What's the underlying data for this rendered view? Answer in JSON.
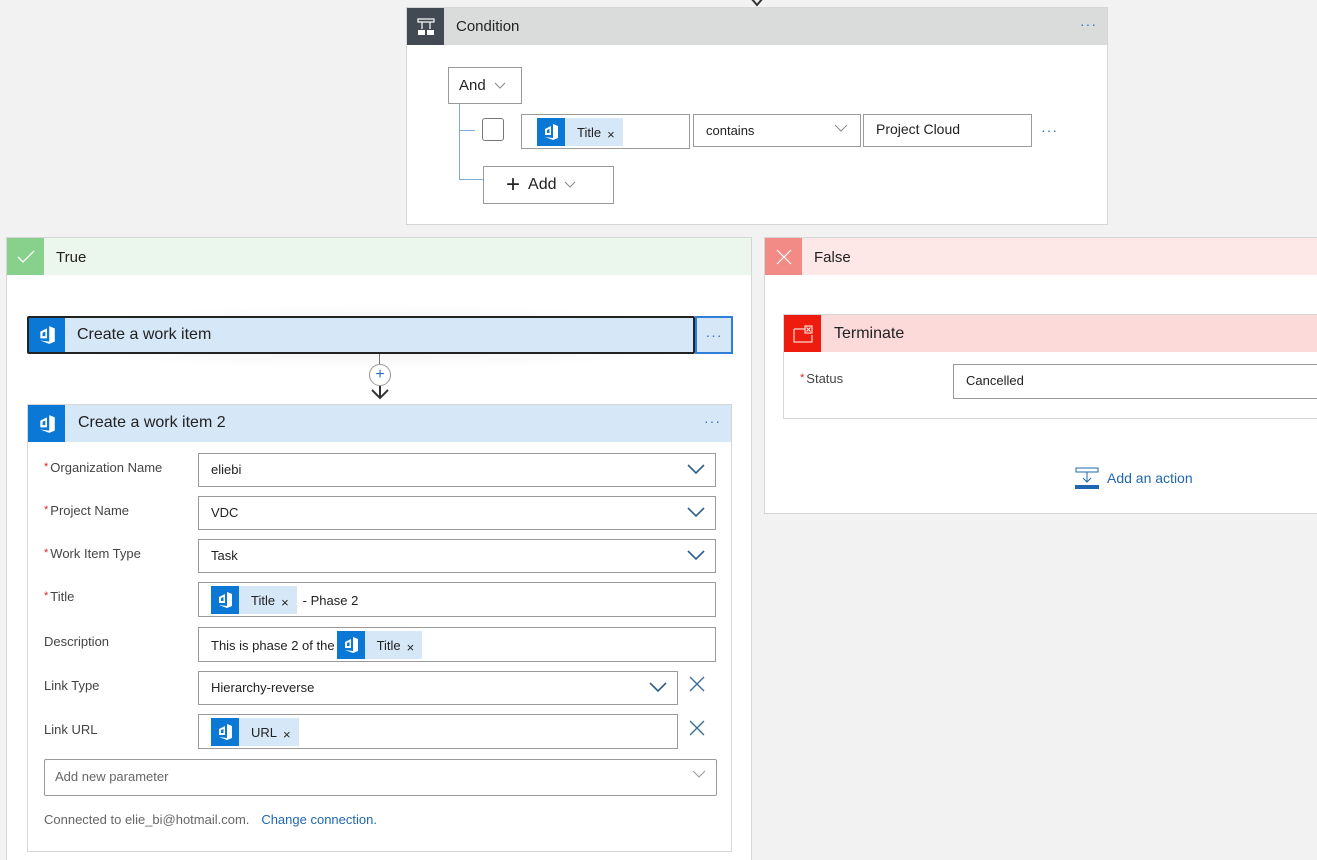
{
  "condition": {
    "title": "Condition",
    "icon": "condition-icon",
    "more_label": "···",
    "operator_group": "And",
    "rows": [
      {
        "left_token": {
          "label": "Title",
          "remove": "×",
          "icon": "azure-devops-icon"
        },
        "operator": "contains",
        "right_value": "Project Cloud",
        "more_label": "···"
      }
    ],
    "add_label": "Add"
  },
  "true_branch": {
    "title": "True",
    "icon": "check-icon",
    "actions": [
      {
        "title": "Create a work item",
        "more_label": "···"
      },
      {
        "title": "Create a work item 2",
        "more_label": "···",
        "params": {
          "org": {
            "label": "Organization Name",
            "required": true,
            "value": "eliebi"
          },
          "project": {
            "label": "Project Name",
            "required": true,
            "value": "VDC"
          },
          "type": {
            "label": "Work Item Type",
            "required": true,
            "value": "Task"
          },
          "title": {
            "label": "Title",
            "required": true,
            "token": "Title",
            "token_remove": "×",
            "suffix": "- Phase 2"
          },
          "description": {
            "label": "Description",
            "required": false,
            "prefix": "This is phase 2 of the",
            "token": "Title",
            "token_remove": "×"
          },
          "link_type": {
            "label": "Link Type",
            "required": false,
            "value": "Hierarchy-reverse"
          },
          "link_url": {
            "label": "Link URL",
            "required": false,
            "token": "URL",
            "token_remove": "×"
          }
        },
        "add_param_placeholder": "Add new parameter",
        "connection_text": "Connected to elie_bi@hotmail.com.",
        "change_connection": "Change connection."
      }
    ],
    "insert_step_label": "+"
  },
  "false_branch": {
    "title": "False",
    "icon": "close-icon",
    "terminate": {
      "title": "Terminate",
      "status_label": "Status",
      "status_value": "Cancelled"
    },
    "add_action_label": "Add an action"
  },
  "colors": {
    "accent": "#0a78d4",
    "true_green": "#87d18d",
    "false_red": "#f28b86",
    "terminate_red": "#ee1c0e",
    "link_blue": "#1f67b0",
    "required_red": "#d9242b"
  }
}
